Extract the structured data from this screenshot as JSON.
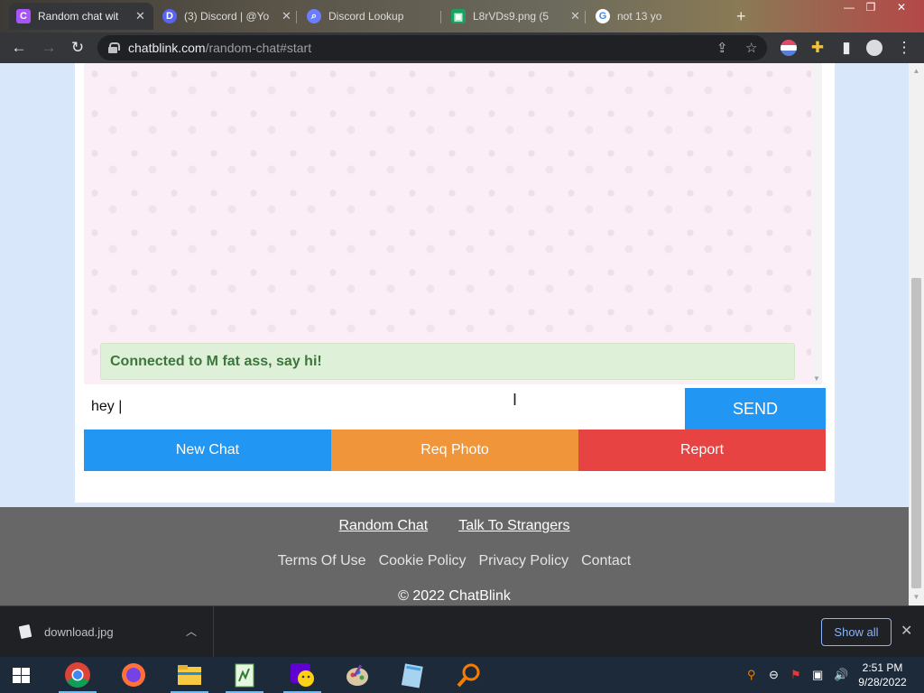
{
  "browser": {
    "tabs": [
      {
        "label": "Random chat wit",
        "favicon": "C",
        "favicon_color": "#a855f7",
        "active": true
      },
      {
        "label": "(3) Discord | @Yo",
        "favicon": "D",
        "favicon_color": "#5865f2",
        "active": false
      },
      {
        "label": "Discord Lookup",
        "favicon": "search-icon",
        "favicon_color": "#6b7cff",
        "active": false
      },
      {
        "label": "L8rVDs9.png (5",
        "favicon": "image-icon",
        "favicon_color": "#1aa260",
        "active": false
      },
      {
        "label": "not 13 yo",
        "favicon": "G",
        "favicon_color": "#4285f4",
        "active": false
      }
    ],
    "url_host": "chatblink.com",
    "url_path": "/random-chat#start"
  },
  "page": {
    "status_message": "Connected to M fat ass, say hi!",
    "input_value": "hey |",
    "send_label": "SEND",
    "actions": [
      {
        "label": "New Chat",
        "color": "#2196f3"
      },
      {
        "label": "Req Photo",
        "color": "#f0953a"
      },
      {
        "label": "Report",
        "color": "#e84343"
      }
    ],
    "footer": {
      "primary_links": [
        "Random Chat",
        "Talk To Strangers"
      ],
      "secondary_links": [
        "Terms Of Use",
        "Cookie Policy",
        "Privacy Policy",
        "Contact"
      ],
      "copyright": "© 2022 ChatBlink"
    }
  },
  "downloads": {
    "file_name": "download.jpg",
    "show_all_label": "Show all"
  },
  "taskbar": {
    "apps": [
      "chrome",
      "firefox",
      "file-explorer",
      "notepad",
      "yahoo-messenger",
      "paint",
      "notepad-plus",
      "search"
    ],
    "time": "2:51 PM",
    "date": "9/28/2022"
  }
}
